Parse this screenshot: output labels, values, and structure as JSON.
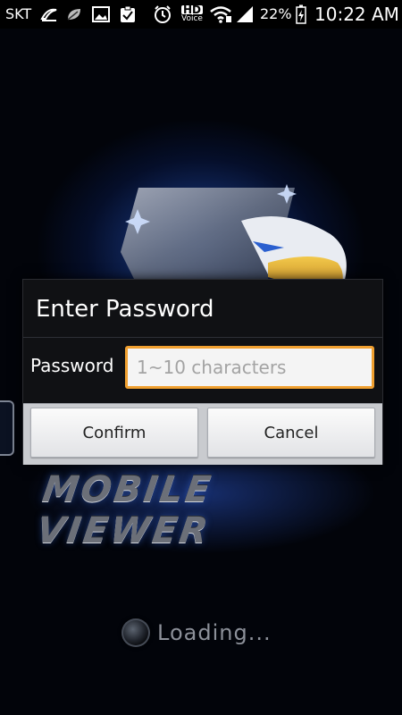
{
  "status_bar": {
    "carrier": "SKT",
    "hd_voice_top": "HD",
    "hd_voice_bottom": "Voice",
    "battery_percent": "22%",
    "time": "10:22 AM"
  },
  "background": {
    "app_logo_text": "MOBILE VIEWER",
    "loading_text": "Loading..."
  },
  "dialog": {
    "title": "Enter Password",
    "password_label": "Password",
    "password_placeholder": "1~10 characters",
    "password_value": "",
    "confirm_label": "Confirm",
    "cancel_label": "Cancel",
    "accent_color": "#f0a030"
  }
}
